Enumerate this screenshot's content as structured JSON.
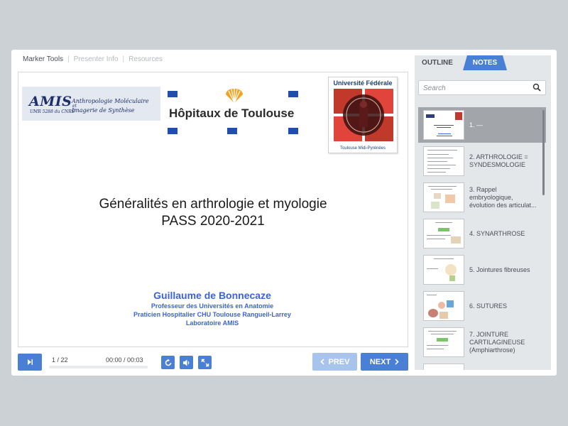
{
  "top_links": {
    "marker_tools": "Marker Tools",
    "presenter_info": "Presenter Info",
    "resources": "Resources",
    "separator": "|"
  },
  "slide": {
    "amis_logo": {
      "word": "AMIS",
      "sub": "UMR 5288 du CNRS",
      "line1": "Anthropologie Moléculaire",
      "et": "et",
      "line2": "Imagerie de Synthèse"
    },
    "hopitaux_logo": "Hôpitaux de Toulouse",
    "univ_logo": {
      "title": "Université Fédérale",
      "subtitle": "Toulouse Midi-Pyrénées"
    },
    "title_line1": "Généralités en arthrologie et myologie",
    "title_line2": "PASS 2020-2021",
    "author_name": "Guillaume de Bonnecaze",
    "author_line1": "Professeur des Universités en Anatomie",
    "author_line2": "Praticien Hospitalier CHU Toulouse Rangueil-Larrey",
    "author_line3": "Laboratoire AMIS"
  },
  "controls": {
    "slide_counter": "1 / 22",
    "time_counter": "00:00 / 00:03",
    "progress": 0,
    "prev_label": "PREV",
    "next_label": "NEXT"
  },
  "sidebar": {
    "tab_outline": "OUTLINE",
    "tab_notes": "NOTES",
    "search_placeholder": "Search",
    "items": [
      {
        "label": "1. —",
        "selected": true
      },
      {
        "label": "2. ARTHROLOGIE = SYNDESMOLOGIE"
      },
      {
        "label": "3. Rappel embryologique, évolution des articulat..."
      },
      {
        "label": "4. SYNARTHROSE"
      },
      {
        "label": "5. Jointures fibreuses"
      },
      {
        "label": "6. SUTURES"
      },
      {
        "label": "7. JOINTURE CARTILAGINEUSE (Amphiarthrose)"
      }
    ]
  },
  "colors": {
    "accent": "#4a7fd6",
    "author_blue": "#3c62d9",
    "sidebar_bg": "#e4e7ea",
    "selected_item": "#a2a6ab"
  }
}
